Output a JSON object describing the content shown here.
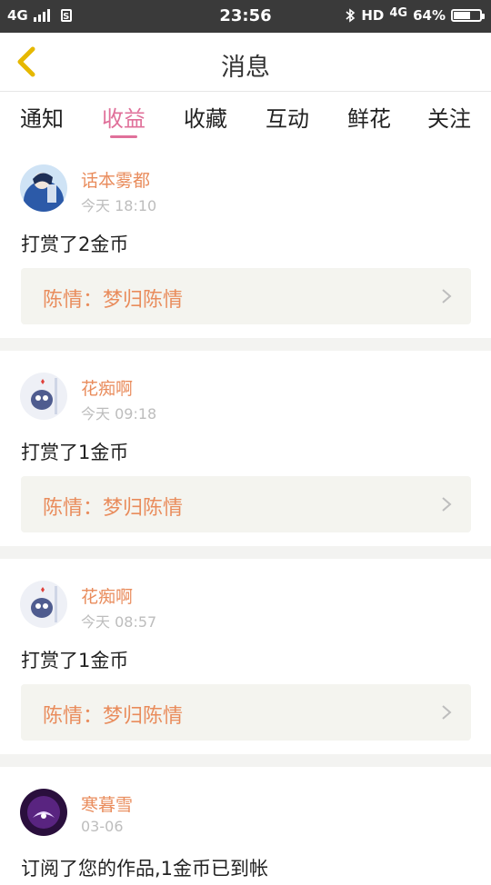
{
  "status_bar": {
    "network": "4G",
    "time": "23:56",
    "bt_hd": "HD",
    "network2": "4G",
    "battery": "64%",
    "battery_level": 0.64
  },
  "header": {
    "title": "消息"
  },
  "tabs": [
    {
      "label": "通知"
    },
    {
      "label": "收益"
    },
    {
      "label": "收藏"
    },
    {
      "label": "互动"
    },
    {
      "label": "鲜花"
    },
    {
      "label": "关注"
    }
  ],
  "active_tab": "收益",
  "messages": [
    {
      "name": "话本雾都",
      "time": "今天 18:10",
      "text": "打赏了2金币",
      "work": "陈情：梦归陈情",
      "avatar": "avatar-blue-figure"
    },
    {
      "name": "花痴啊",
      "time": "今天 09:18",
      "text": "打赏了1金币",
      "work": "陈情：梦归陈情",
      "avatar": "avatar-cat"
    },
    {
      "name": "花痴啊",
      "time": "今天 08:57",
      "text": "打赏了1金币",
      "work": "陈情：梦归陈情",
      "avatar": "avatar-cat"
    },
    {
      "name": "寒暮雪",
      "time": "03-06",
      "text": "订阅了您的作品,1金币已到帐",
      "avatar": "avatar-purple"
    }
  ],
  "colors": {
    "accent": "#e0709a",
    "name": "#e98c5c",
    "back_icon": "#e6b800",
    "card_bg": "#f4f4ef"
  }
}
